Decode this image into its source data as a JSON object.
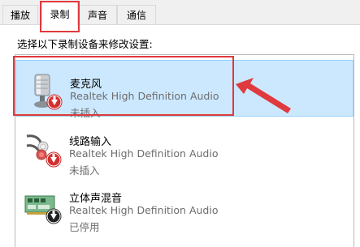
{
  "tabs": [
    {
      "label": "播放"
    },
    {
      "label": "录制"
    },
    {
      "label": "声音"
    },
    {
      "label": "通信"
    }
  ],
  "active_tab": "录制",
  "instruction": "选择以下录制设备来修改设置:",
  "devices": [
    {
      "name": "麦克风",
      "driver": "Realtek High Definition Audio",
      "status": "未插入",
      "icon": "microphone-icon",
      "badge": "red-down-arrow-badge"
    },
    {
      "name": "线路输入",
      "driver": "Realtek High Definition Audio",
      "status": "未插入",
      "icon": "line-in-cable-icon",
      "badge": "red-down-arrow-badge"
    },
    {
      "name": "立体声混音",
      "driver": "Realtek High Definition Audio",
      "status": "已停用",
      "icon": "sound-card-icon",
      "badge": "black-down-arrow-badge"
    }
  ],
  "colors": {
    "selection": "#cce8ff",
    "annotation": "#e0393e",
    "badge_red": "#d32f2f"
  }
}
